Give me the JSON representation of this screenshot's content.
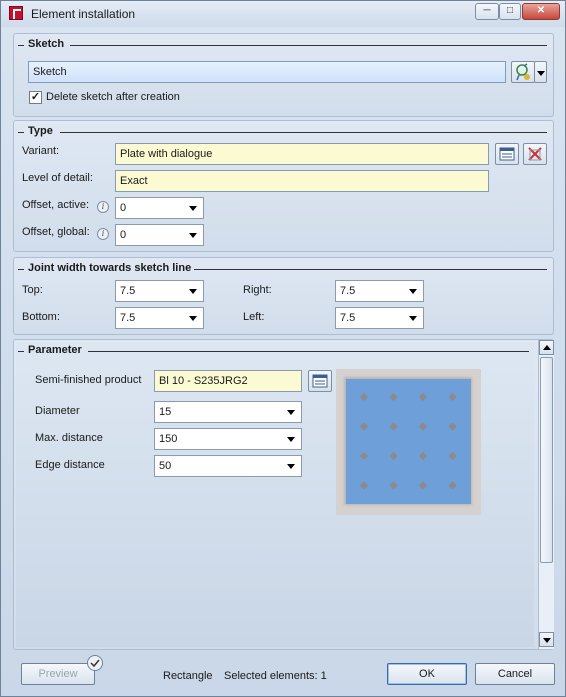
{
  "window": {
    "title": "Element installation",
    "controls": {
      "minimize": "─",
      "maximize": "□",
      "close": "✕"
    }
  },
  "sketch": {
    "heading": "Sketch",
    "field_value": "Sketch",
    "delete_checkbox_label": "Delete sketch after creation",
    "delete_checked": true,
    "check_mark": "✓"
  },
  "type": {
    "heading": "Type",
    "variant_label": "Variant:",
    "variant_value": "Plate with dialogue",
    "detail_label": "Level of detail:",
    "detail_value": "Exact",
    "offset_active_label": "Offset, active:",
    "offset_active_value": "0",
    "offset_global_label": "Offset, global:",
    "offset_global_value": "0",
    "info_glyph": "i"
  },
  "joint": {
    "heading": "Joint width towards sketch line",
    "top_label": "Top:",
    "top_value": "7.5",
    "right_label": "Right:",
    "right_value": "7.5",
    "bottom_label": "Bottom:",
    "bottom_value": "7.5",
    "left_label": "Left:",
    "left_value": "7.5"
  },
  "parameter": {
    "heading": "Parameter",
    "product_label": "Semi-finished product",
    "product_value": "Bl 10 - S235JRG2",
    "diameter_label": "Diameter",
    "diameter_value": "15",
    "max_distance_label": "Max. distance",
    "max_distance_value": "150",
    "edge_distance_label": "Edge distance",
    "edge_distance_value": "50",
    "preview_grid": {
      "rows": 4,
      "cols": 4
    },
    "colors": {
      "plate": "#6f9fd8",
      "dot": "#8c8a8f"
    }
  },
  "footer": {
    "preview_label": "Preview",
    "shape_text": "Rectangle",
    "selected_text": "Selected elements: 1",
    "ok_label": "OK",
    "cancel_label": "Cancel"
  }
}
